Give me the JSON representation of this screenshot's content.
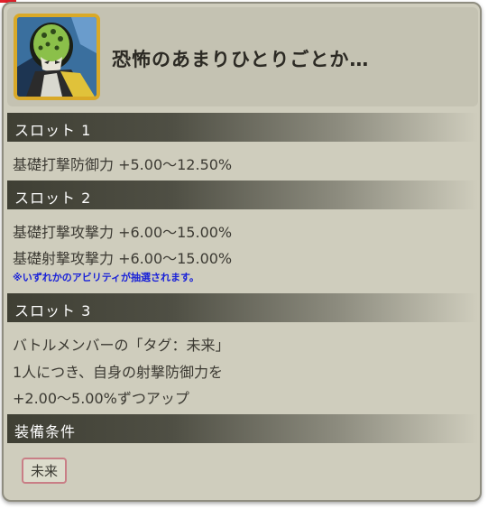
{
  "item": {
    "title": "恐怖のあまりひとりごとか…",
    "icon": "cell-character-portrait-icon"
  },
  "slots": [
    {
      "label": "スロット 1",
      "lines": [
        "基礎打撃防御力 +5.00〜12.50%"
      ]
    },
    {
      "label": "スロット 2",
      "lines": [
        "基礎打撃攻撃力 +6.00〜15.00%",
        "基礎射撃攻撃力 +6.00〜15.00%"
      ],
      "note": "※いずれかのアビリティが抽選されます。"
    },
    {
      "label": "スロット 3",
      "lines": [
        "バトルメンバーの「タグ：未来」",
        "1人につき、自身の射撃防御力を",
        "+2.00〜5.00%ずつアップ"
      ]
    }
  ],
  "equip": {
    "label": "装備条件",
    "tag": "未来"
  },
  "colors": {
    "panel_bg": "#cfcdbd",
    "bar_dark": "#3f3f34",
    "note_blue": "#1a22d8",
    "icon_frame_gold": "#d9a928",
    "tag_border": "#c97e86"
  }
}
